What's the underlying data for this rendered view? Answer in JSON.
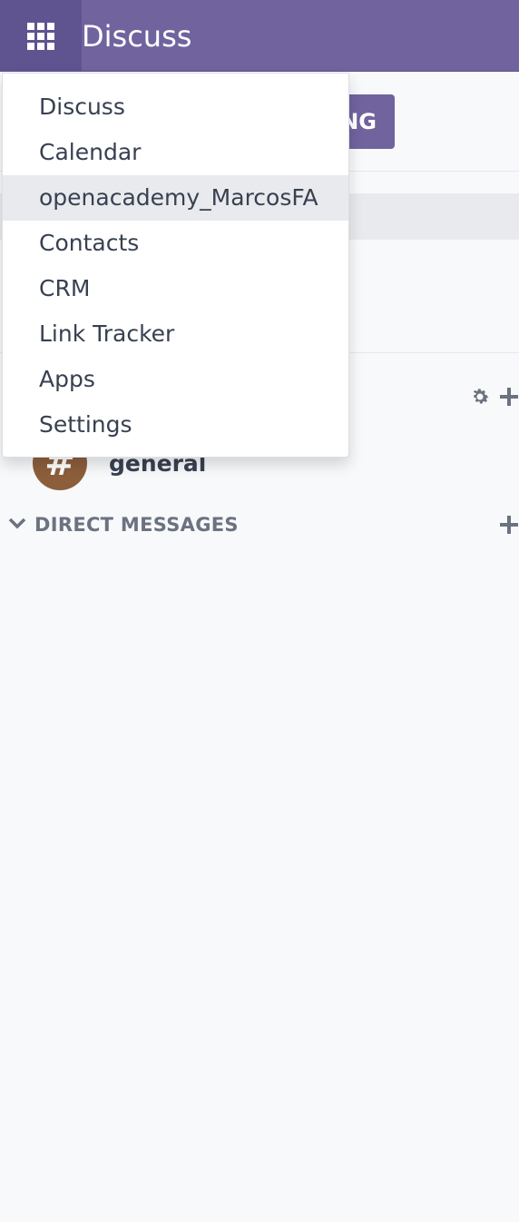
{
  "navbar": {
    "app_title": "Discuss",
    "apps_icon": "grid-icon",
    "color": "#71639e"
  },
  "apps_menu": {
    "items": [
      {
        "label": "Discuss",
        "active": false
      },
      {
        "label": "Calendar",
        "active": false
      },
      {
        "label": "openacademy_MarcosFA",
        "active": true
      },
      {
        "label": "Contacts",
        "active": false
      },
      {
        "label": "CRM",
        "active": false
      },
      {
        "label": "Link Tracker",
        "active": false
      },
      {
        "label": "Apps",
        "active": false
      },
      {
        "label": "Settings",
        "active": false
      }
    ]
  },
  "content": {
    "start_button_label_visible": "NG",
    "channels": [
      {
        "name": "general",
        "avatar_symbol": "#"
      }
    ],
    "channel_tools_icons": [
      "gear-icon",
      "plus-icon"
    ],
    "direct_messages": {
      "label": "DIRECT MESSAGES",
      "expand_icon": "chevron-down-icon",
      "add_icon": "plus-icon"
    }
  }
}
